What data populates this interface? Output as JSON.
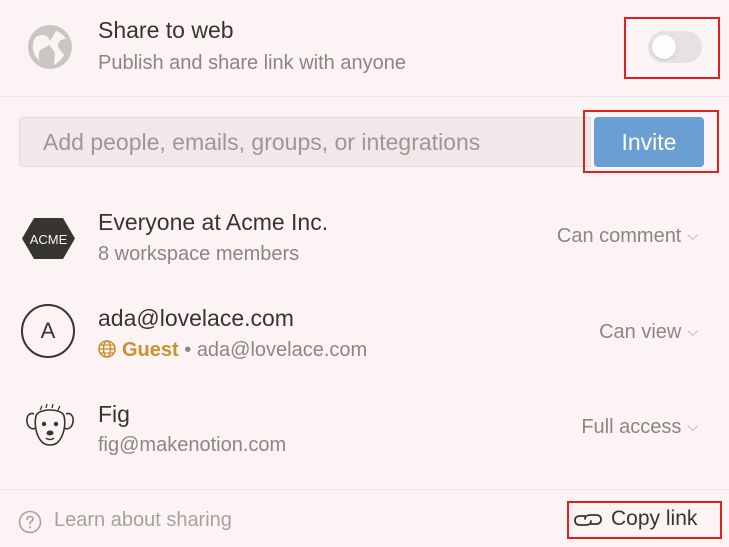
{
  "share_web": {
    "title": "Share to web",
    "subtitle": "Publish and share link with anyone",
    "toggle_on": false,
    "icon": "globe-icon"
  },
  "invite": {
    "placeholder": "Add people, emails, groups, or integrations",
    "button_label": "Invite"
  },
  "members": [
    {
      "name": "Everyone at Acme Inc.",
      "subtitle": "8 workspace members",
      "permission": "Can comment",
      "avatar": "acme-logo",
      "logo_text": "ACME"
    },
    {
      "name": "ada@lovelace.com",
      "badge": "Guest",
      "subtitle": "ada@lovelace.com",
      "permission": "Can view",
      "avatar_letter": "A"
    },
    {
      "name": "Fig",
      "subtitle": "fig@makenotion.com",
      "permission": "Full access",
      "avatar": "dog-avatar"
    }
  ],
  "footer": {
    "learn_label": "Learn about sharing",
    "copy_link_label": "Copy link"
  },
  "colors": {
    "background": "#fcf3f4",
    "invite_button": "#6a9fd3",
    "guest": "#c8922d",
    "highlight": "#e02020"
  }
}
